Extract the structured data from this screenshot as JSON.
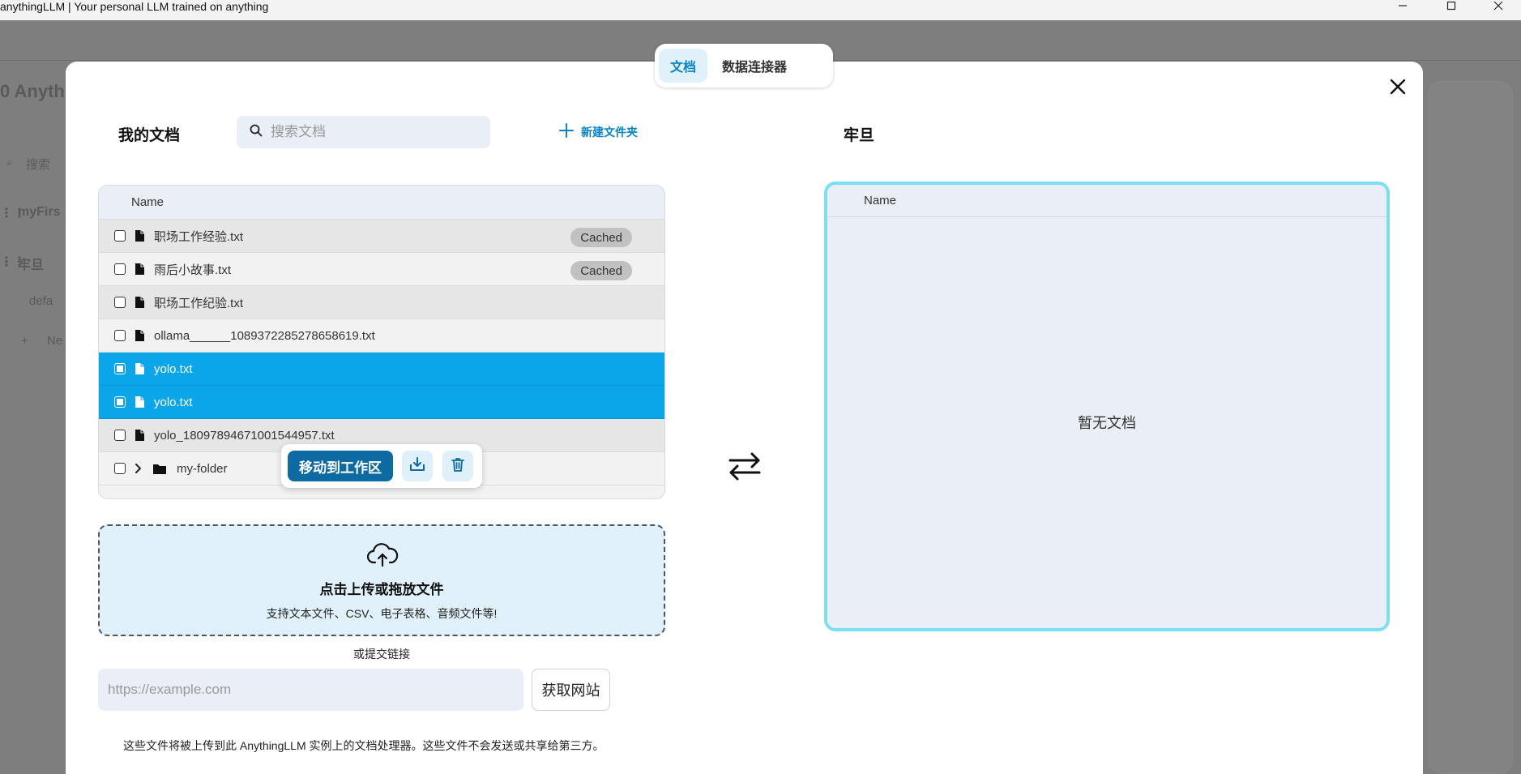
{
  "window": {
    "title": "anythingLLM | Your personal LLM trained on anything"
  },
  "background": {
    "app_name_fragment": "0 Anyth",
    "search_placeholder": "搜索",
    "workspace_1": "myFirs",
    "workspace_2": "牢旦",
    "thread_label": "defa",
    "new_label": "Ne"
  },
  "tabs": [
    {
      "label": "文档",
      "active": true
    },
    {
      "label": "数据连接器",
      "active": false
    }
  ],
  "my_docs": {
    "title": "我的文档",
    "search_placeholder": "搜索文档",
    "new_folder_label": "新建文件夹",
    "column_name": "Name",
    "rows": [
      {
        "name": "职场工作经验.txt",
        "badge": "Cached",
        "selected": false,
        "type": "file"
      },
      {
        "name": "雨后小故事.txt",
        "badge": "Cached",
        "selected": false,
        "type": "file"
      },
      {
        "name": "职场工作纪验.txt",
        "badge": "",
        "selected": false,
        "type": "file"
      },
      {
        "name": "ollama______1089372285278658619.txt",
        "badge": "",
        "selected": false,
        "type": "file"
      },
      {
        "name": "yolo.txt",
        "badge": "",
        "selected": true,
        "type": "file"
      },
      {
        "name": "yolo.txt",
        "badge": "",
        "selected": true,
        "type": "file"
      },
      {
        "name": "yolo_1809789467100154495​7.txt",
        "badge": "",
        "selected": false,
        "type": "file"
      },
      {
        "name": "my-folder",
        "badge": "",
        "selected": false,
        "type": "folder"
      }
    ]
  },
  "action_bar": {
    "move_label": "移动到工作区"
  },
  "upload": {
    "title": "点击上传或拖放文件",
    "subtitle": "支持文本文件、CSV、电子表格、音频文件等!",
    "or_link": "或提交链接",
    "url_placeholder": "https://example.com",
    "fetch_label": "获取网站",
    "disclaimer": "这些文件将被上传到此 AnythingLLM 实例上的文档处理器。这些文件不会发送或共享给第三方。"
  },
  "workspace": {
    "title": "牢旦",
    "column_name": "Name",
    "empty_text": "暂无文档"
  },
  "colors": {
    "accent": "#0ba5e9",
    "move_button": "#0e6aa3",
    "workspace_border": "#7bdff2"
  }
}
